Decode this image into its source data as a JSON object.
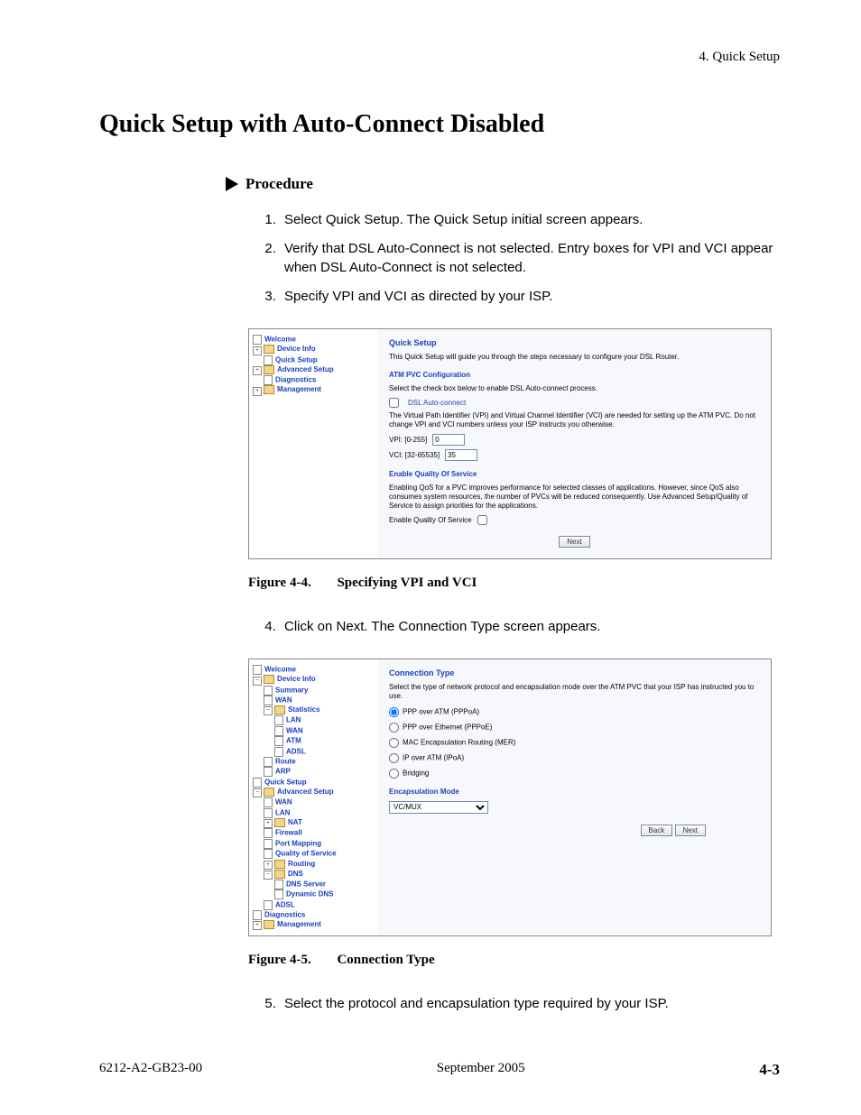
{
  "header": {
    "chapter": "4. Quick Setup"
  },
  "title": "Quick Setup with Auto-Connect Disabled",
  "procedure_label": "Procedure",
  "steps_a": [
    "Select Quick Setup. The Quick Setup initial screen appears.",
    "Verify that DSL Auto-Connect is not selected. Entry boxes for VPI and VCI appear when DSL Auto-Connect is not selected.",
    "Specify VPI and VCI as directed by your ISP."
  ],
  "fig44": {
    "num": "Figure 4-4.",
    "title": "Specifying VPI and VCI"
  },
  "steps_b": [
    "Click on Next. The Connection Type screen appears."
  ],
  "fig45": {
    "num": "Figure 4-5.",
    "title": "Connection Type"
  },
  "steps_c": [
    "Select the protocol and encapsulation type required by your ISP."
  ],
  "shot1": {
    "tree": {
      "welcome": "Welcome",
      "device_info": "Device Info",
      "quick_setup": "Quick Setup",
      "advanced_setup": "Advanced Setup",
      "diagnostics": "Diagnostics",
      "management": "Management"
    },
    "h": "Quick Setup",
    "intro": "This Quick Setup will guide you through the steps necessary to configure your DSL Router.",
    "sub1": "ATM PVC Configuration",
    "checkhint": "Select the check box below to enable DSL Auto-connect process.",
    "checklabel": "DSL Auto-connect",
    "vpivci_help": "The Virtual Path Identifier (VPI) and Virtual Channel Identifier (VCI) are needed for setting up the ATM PVC. Do not change VPI and VCI numbers unless your ISP instructs you otherwise.",
    "vpi_label": "VPI: [0-255]",
    "vpi_value": "0",
    "vci_label": "VCI: [32-65535]",
    "vci_value": "35",
    "sub2": "Enable Quality Of Service",
    "qos_help": "Enabling QoS for a PVC improves performance for selected classes of applications. However, since QoS also consumes system resources, the number of PVCs will be reduced consequently. Use Advanced Setup/Quality of Service to assign priorities for the applications.",
    "qos_label": "Enable Quality Of Service",
    "next": "Next"
  },
  "shot2": {
    "tree": {
      "welcome": "Welcome",
      "device_info": "Device Info",
      "summary": "Summary",
      "wan": "WAN",
      "statistics": "Statistics",
      "lan": "LAN",
      "s_wan": "WAN",
      "atm": "ATM",
      "adsl": "ADSL",
      "route": "Route",
      "arp": "ARP",
      "quick_setup": "Quick Setup",
      "advanced_setup": "Advanced Setup",
      "a_wan": "WAN",
      "a_lan": "LAN",
      "nat": "NAT",
      "firewall": "Firewall",
      "port_mapping": "Port Mapping",
      "qos": "Quality of Service",
      "routing": "Routing",
      "dns": "DNS",
      "dns_server": "DNS Server",
      "dyn_dns": "Dynamic DNS",
      "adsl2": "ADSL",
      "diagnostics": "Diagnostics",
      "management": "Management"
    },
    "h": "Connection Type",
    "intro": "Select the type of network protocol and encapsulation mode over the ATM PVC that your ISP has instructed you to use.",
    "r1": "PPP over ATM (PPPoA)",
    "r2": "PPP over Ethernet (PPPoE)",
    "r3": "MAC Encapsulation Routing (MER)",
    "r4": "IP over ATM (IPoA)",
    "r5": "Bridging",
    "enc_h": "Encapsulation Mode",
    "enc_val": "VC/MUX",
    "back": "Back",
    "next": "Next"
  },
  "footer": {
    "doc": "6212-A2-GB23-00",
    "date": "September 2005",
    "page": "4-3"
  }
}
